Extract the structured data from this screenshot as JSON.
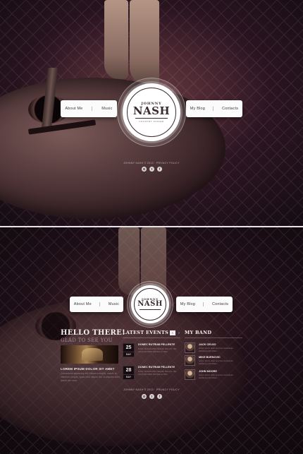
{
  "nav": {
    "left": [
      "About Me",
      "Music"
    ],
    "right": [
      "My Blog",
      "Contacts"
    ]
  },
  "logo": {
    "first": "JOHNNY",
    "last": "NASH",
    "tagline": "COUNTRY SINGER"
  },
  "footer": {
    "copyright": "JOHNNY NASH © 2013 · PRIVACY POLICY",
    "socials": [
      {
        "icon": "rss-icon",
        "glyph": "⊙"
      },
      {
        "icon": "twitter-icon",
        "glyph": "t"
      },
      {
        "icon": "facebook-icon",
        "glyph": "f"
      }
    ]
  },
  "welcome": {
    "heading": "HELLO THERE!",
    "subheading": "GLAD TO SEE YOU",
    "post_title": "LOREM IPSUM DOLOR SIT AMET",
    "post_text": "Consectetur adipiscing elit. Nullam convallis, mauris at interdum congue, ligula nunc aliquet nisi, ut aliquam dolor ipsum nec nunc."
  },
  "events": {
    "heading": "LATEST EVENTS",
    "prev": "‹",
    "next": "›",
    "items": [
      {
        "day": "25",
        "month": "MAY",
        "title": "DONEC RUTRUM PELLENTE",
        "text": "NUNC MALESUADA NEQUE TELLUS, VEL ALIQUAM NIBH FRINGILLA NEC."
      },
      {
        "day": "28",
        "month": "MAY",
        "title": "DONEC RUTRUM PELLENTE",
        "text": "NUNC MALESUADA NEQUE TELLUS, VEL ALIQUAM NIBH FRINGILLA NEC."
      }
    ]
  },
  "band": {
    "heading": "MY BAND",
    "members": [
      {
        "name": "JACK CELSO",
        "text": "Lorem ipsum dolor sit amet consectetur adipiscing elit nullam."
      },
      {
        "name": "MIKE BURNOVIC",
        "text": "Lorem ipsum dolor sit amet consectetur adipiscing elit nullam."
      },
      {
        "name": "JOHN MOORE",
        "text": "Lorem ipsum dolor sit amet consectetur adipiscing elit nullam."
      }
    ]
  }
}
